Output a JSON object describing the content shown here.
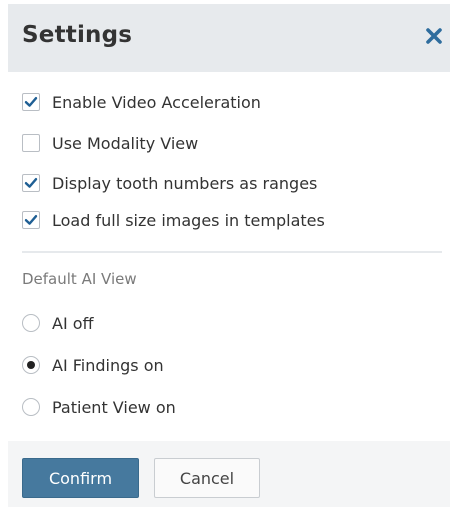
{
  "dialog": {
    "title": "Settings",
    "close_icon": "close-icon"
  },
  "checkboxes": [
    {
      "label": "Enable Video Acceleration",
      "checked": true
    },
    {
      "label": "Use Modality View",
      "checked": false
    },
    {
      "label": "Display tooth numbers as ranges",
      "checked": true
    },
    {
      "label": "Load full size images in templates",
      "checked": true
    }
  ],
  "ai_view": {
    "section_label": "Default AI View",
    "options": [
      {
        "label": "AI off",
        "selected": false
      },
      {
        "label": "AI Findings on",
        "selected": true
      },
      {
        "label": "Patient View on",
        "selected": false
      }
    ]
  },
  "footer": {
    "confirm_label": "Confirm",
    "cancel_label": "Cancel"
  },
  "colors": {
    "header_bg": "#e7eaed",
    "primary_button": "#46799e",
    "close_icon": "#2f6d9e"
  }
}
